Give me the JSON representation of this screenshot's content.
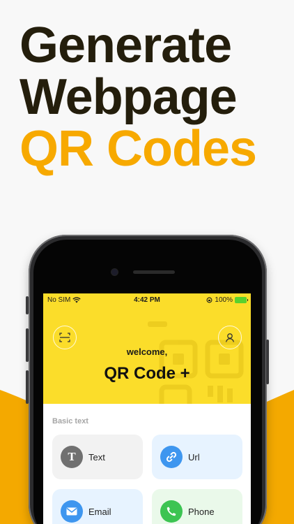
{
  "headline": {
    "line1": "Generate",
    "line2": "Webpage",
    "line3": "QR Codes"
  },
  "colors": {
    "accent": "#f7a900",
    "hero_yellow": "#fbdd2a",
    "headline_dark": "#241e0c"
  },
  "status_bar": {
    "carrier": "No SIM",
    "time": "4:42 PM",
    "battery": "100%"
  },
  "hero": {
    "scan_icon": "scan-frame-icon",
    "profile_icon": "user-icon",
    "welcome": "welcome,",
    "title": "QR Code +"
  },
  "section": {
    "label": "Basic text"
  },
  "cards": [
    {
      "label": "Text",
      "icon": "text-t-icon"
    },
    {
      "label": "Url",
      "icon": "link-icon"
    },
    {
      "label": "Email",
      "icon": "mail-icon"
    },
    {
      "label": "Phone",
      "icon": "phone-icon"
    }
  ]
}
